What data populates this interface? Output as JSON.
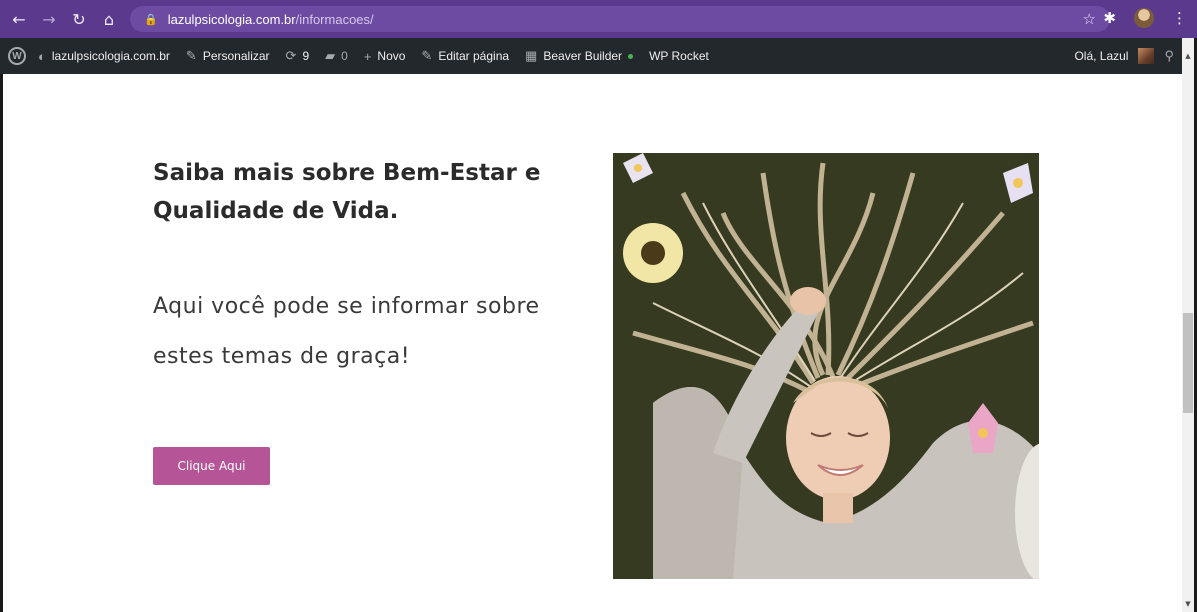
{
  "browser": {
    "url_host": "lazulpsicologia.com.br",
    "url_path": "/informacoes/",
    "icons": [
      "back-arrow-icon",
      "forward-arrow-icon",
      "reload-icon",
      "home-icon",
      "lock-icon",
      "star-icon",
      "extensions-icon",
      "menu-dots-icon"
    ],
    "accent": "#5b3a8e"
  },
  "wp_admin_bar": {
    "site_name": "lazulpsicologia.com.br",
    "personalizar": "Personalizar",
    "updates_count": "9",
    "comments_count": "0",
    "novo": "Novo",
    "editar": "Editar página",
    "beaver": "Beaver Builder",
    "rocket": "WP Rocket",
    "greeting": "Olá, Lazul",
    "bg_color": "#23282d"
  },
  "page": {
    "heading": "Saiba mais sobre Bem-Estar e Qualidade de Vida.",
    "subtext": "Aqui você pode se informar sobre estes temas de graça!",
    "cta_label": "Clique Aqui",
    "cta_color": "#b55497",
    "photo_subject": "woman-lying-on-grass-with-flowers"
  }
}
